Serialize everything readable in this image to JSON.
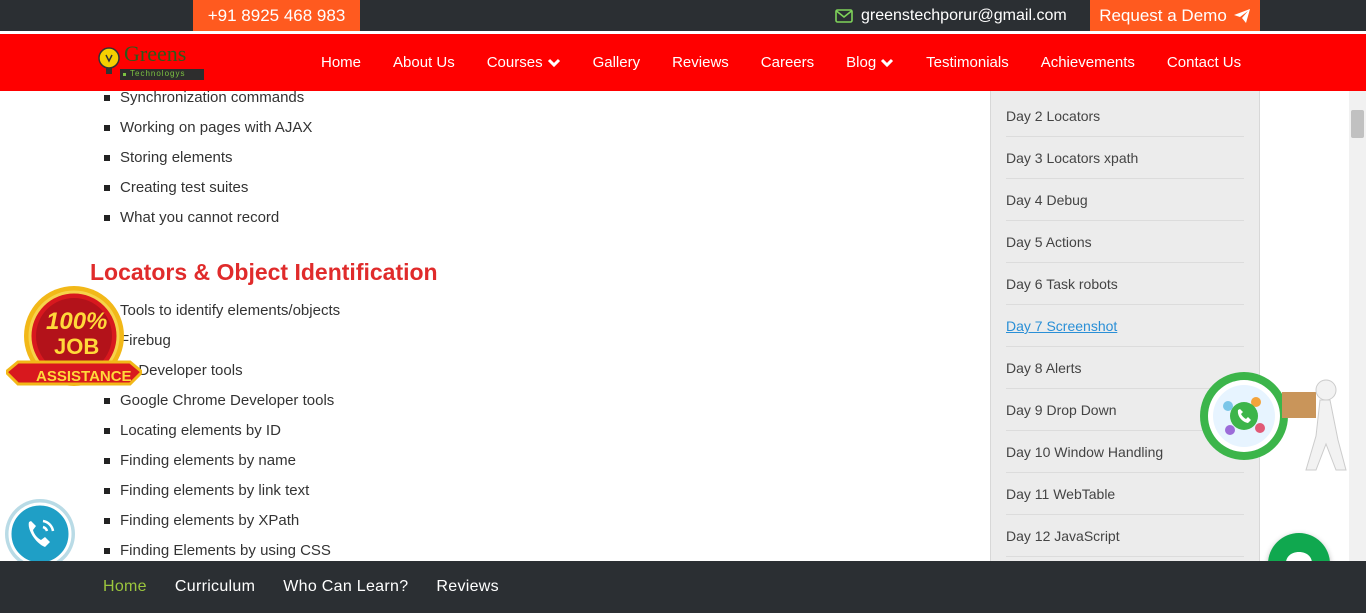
{
  "topbar": {
    "phone": "+91 8925 468 983",
    "email": "greenstechporur@gmail.com",
    "demo_label": "Request a Demo",
    "accent": "#ff5a1f",
    "bg": "#2b2f33"
  },
  "nav": {
    "logo_text": "Greens",
    "logo_subtext": "Technologys",
    "bg": "#ff0000",
    "items": [
      {
        "label": "Home"
      },
      {
        "label": "About Us"
      },
      {
        "label": "Courses"
      },
      {
        "label": "Gallery"
      },
      {
        "label": "Reviews"
      },
      {
        "label": "Careers"
      },
      {
        "label": "Blog"
      },
      {
        "label": "Testimonials"
      },
      {
        "label": "Achievements"
      },
      {
        "label": "Contact Us"
      }
    ]
  },
  "content": {
    "list1": [
      "Synchronization commands",
      "Working on pages with AJAX",
      "Storing elements",
      "Creating test suites",
      "What you cannot record"
    ],
    "section_title": "Locators & Object Identification",
    "list2": [
      "Tools to identify elements/objects",
      "Firebug",
      "IE Developer tools",
      "Google Chrome Developer tools",
      "Locating elements by ID",
      "Finding elements by name",
      "Finding elements by link text",
      "Finding elements by XPath",
      "Finding Elements by using CSS"
    ]
  },
  "sidebar": {
    "items": [
      {
        "label": "Day 2 Locators"
      },
      {
        "label": "Day 3 Locators xpath"
      },
      {
        "label": "Day 4 Debug"
      },
      {
        "label": "Day 5 Actions"
      },
      {
        "label": "Day 6 Task robots"
      },
      {
        "label": "Day 7 Screenshot"
      },
      {
        "label": "Day 8 Alerts"
      },
      {
        "label": "Day 9 Drop Down"
      },
      {
        "label": "Day 10 Window Handling"
      },
      {
        "label": "Day 11 WebTable"
      },
      {
        "label": "Day 12 JavaScript"
      }
    ],
    "active_index": 5
  },
  "badge": {
    "line1": "100%",
    "line2": "JOB",
    "line3": "ASSISTANCE"
  },
  "bottom_tabs": [
    {
      "label": "Home"
    },
    {
      "label": "Curriculum"
    },
    {
      "label": "Who Can Learn?"
    },
    {
      "label": "Reviews"
    }
  ],
  "icons": {
    "email": "envelope-icon",
    "demo": "paper-plane-icon",
    "dropdown": "chevron-down-icon",
    "call": "phone-call-icon",
    "whatsapp": "whatsapp-icon",
    "chat": "chat-bubble-icon"
  }
}
